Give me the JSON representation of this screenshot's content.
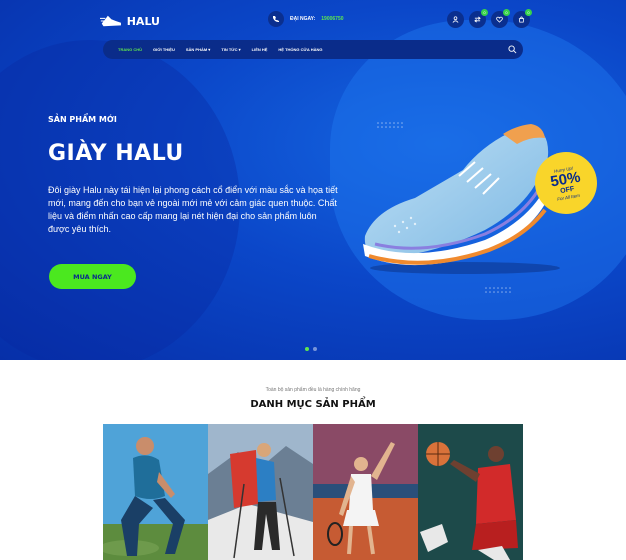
{
  "brand": {
    "name": "HALU"
  },
  "header": {
    "hotline_label": "ĐẠI NGAY:",
    "hotline_number": "19006750",
    "icons": [
      {
        "name": "user-icon",
        "badge": ""
      },
      {
        "name": "compare-icon",
        "badge": "0"
      },
      {
        "name": "heart-icon",
        "badge": "0"
      },
      {
        "name": "cart-icon",
        "badge": "0"
      }
    ]
  },
  "nav": {
    "items": [
      {
        "label": "TRANG CHỦ",
        "active": true
      },
      {
        "label": "GIỚI THIỆU",
        "active": false
      },
      {
        "label": "SẢN PHẨM ▾",
        "active": false
      },
      {
        "label": "TIN TỨC ▾",
        "active": false
      },
      {
        "label": "LIÊN HỆ",
        "active": false
      },
      {
        "label": "HỆ THỐNG CỬA HÀNG",
        "active": false
      }
    ]
  },
  "slide": {
    "subtitle": "SẢN PHẨM MỚI",
    "title": "GIÀY HALU",
    "description": "Đôi giày Halu này tái hiện lại phong cách cổ điển với màu sắc và họa tiết mới, mang đến cho bạn vẻ ngoài mới mẻ với cảm giác quen thuộc. Chất liệu và điểm nhấn cao cấp mang lại nét hiện đại cho sản phẩm luôn được yêu thích.",
    "button": "MUA NGAY",
    "sale_top": "Hurry Up!",
    "sale_percent": "50%",
    "sale_off": "OFF",
    "sale_bottom": "For All Item"
  },
  "slider": {
    "count": 2,
    "active": 0
  },
  "categories": {
    "kicker": "Toàn bộ sản phẩm đều là hàng chính hãng",
    "title": "DANH MỤC SẢN PHẨM",
    "tiles": [
      "running",
      "hiking",
      "tennis",
      "basketball"
    ]
  },
  "colors": {
    "primary": "#0b47c9",
    "accent": "#4be81f",
    "nav_bg": "#0a2c8a",
    "sale": "#f9d52a"
  }
}
